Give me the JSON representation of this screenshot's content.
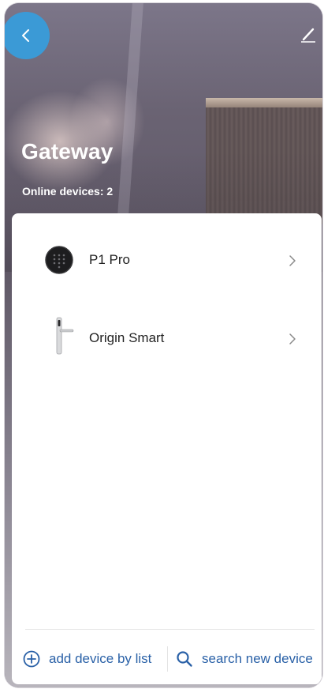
{
  "header": {
    "title": "Gateway",
    "online_devices_label": "Online devices: 2"
  },
  "devices": [
    {
      "name": "P1 Pro",
      "icon": "keypad-device-icon"
    },
    {
      "name": "Origin Smart",
      "icon": "door-handle-device-icon"
    }
  ],
  "actions": {
    "add_by_list_label": "add device by list",
    "search_new_label": "search new device"
  },
  "colors": {
    "accent_blue": "#2a61a7",
    "back_button": "#3b9ad6",
    "title_text": "#ffffff"
  }
}
